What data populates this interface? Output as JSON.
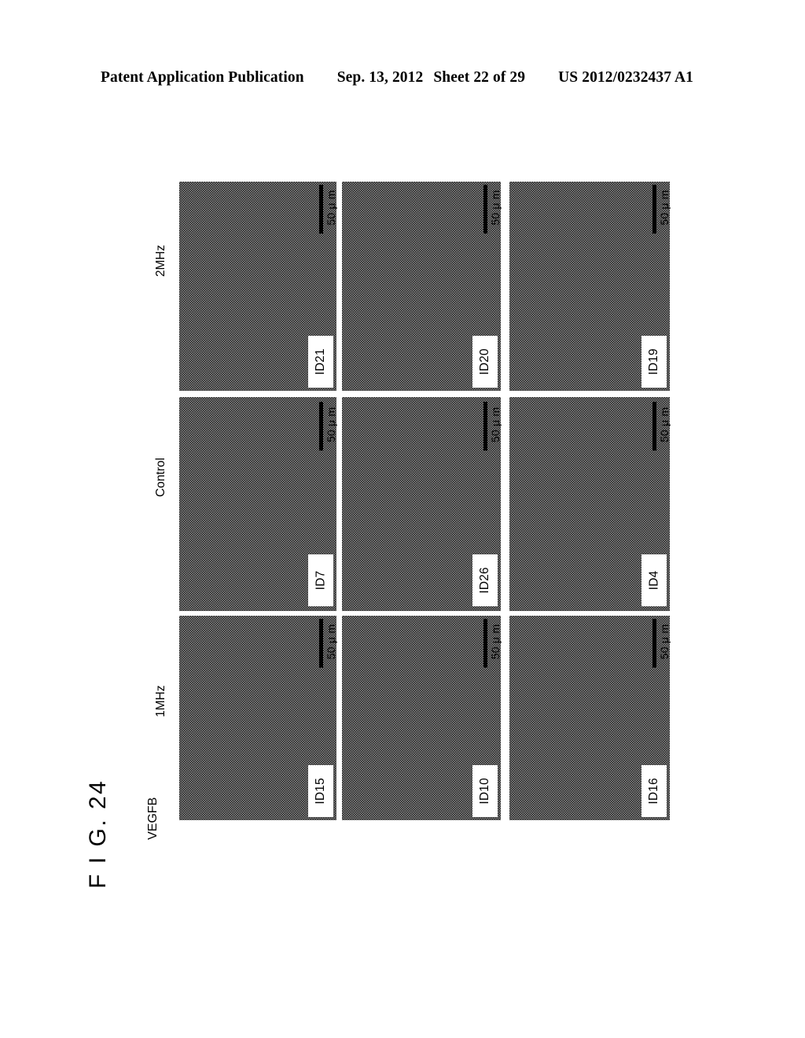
{
  "header": {
    "publication": "Patent Application Publication",
    "date": "Sep. 13, 2012",
    "sheet": "Sheet 22 of 29",
    "patent_number": "US 2012/0232437 A1"
  },
  "figure": {
    "caption": "F I G. 24",
    "group_label": "VEGFB",
    "scale_bar_text": "50 μ m",
    "conditions": [
      {
        "label": "2MHz"
      },
      {
        "label": "Control"
      },
      {
        "label": "1MHz"
      }
    ],
    "panels": [
      {
        "id_label": "ID21",
        "condition": "2MHz",
        "row": 0,
        "col": 0
      },
      {
        "id_label": "ID20",
        "condition": "2MHz",
        "row": 0,
        "col": 1
      },
      {
        "id_label": "ID19",
        "condition": "2MHz",
        "row": 0,
        "col": 2
      },
      {
        "id_label": "ID7",
        "condition": "Control",
        "row": 1,
        "col": 0
      },
      {
        "id_label": "ID26",
        "condition": "Control",
        "row": 1,
        "col": 1
      },
      {
        "id_label": "ID4",
        "condition": "Control",
        "row": 1,
        "col": 2
      },
      {
        "id_label": "ID15",
        "condition": "1MHz",
        "row": 2,
        "col": 0
      },
      {
        "id_label": "ID10",
        "condition": "1MHz",
        "row": 2,
        "col": 1
      },
      {
        "id_label": "ID16",
        "condition": "1MHz",
        "row": 2,
        "col": 2
      }
    ]
  },
  "colors": {
    "ink": "#000000",
    "paper": "#ffffff",
    "halftone_dark": "#1d1d1d",
    "halftone_light": "#8e8e8e"
  }
}
